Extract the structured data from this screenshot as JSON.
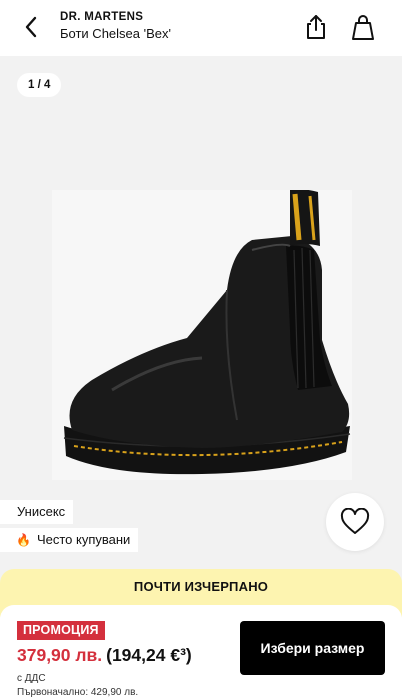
{
  "header": {
    "brand": "DR. MARTENS",
    "product_name": "Боти Chelsea 'Bex'",
    "back_icon": "chevron-left-icon",
    "share_icon": "share-icon",
    "bag_icon": "shopping-bag-icon"
  },
  "gallery": {
    "counter": "1 / 4"
  },
  "tags": {
    "unisex": "Унисекс",
    "frequently_bought": "Често купувани",
    "fire_icon": "🔥"
  },
  "stock": {
    "label": "ПОЧТИ ИЗЧЕРПАНО"
  },
  "purchase": {
    "badge": "ПРОМОЦИЯ",
    "price_current": "379,90 лв.",
    "price_eur": "(194,24 €³)",
    "vat_note": "с ДДС",
    "original_price": "Първоначално: 429,90 лв.",
    "cta_label": "Избери размер"
  },
  "colors": {
    "promo_red": "#d4303d",
    "stock_yellow": "#fdf4b0",
    "cta_black": "#000000"
  }
}
